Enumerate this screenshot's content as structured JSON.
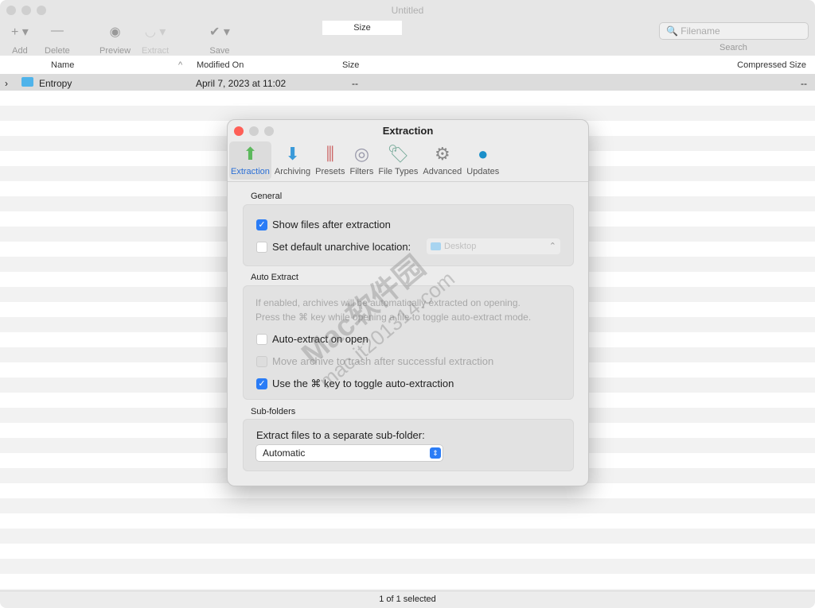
{
  "window": {
    "title": "Untitled",
    "status": "1 of 1 selected"
  },
  "toolbar": {
    "add": "Add",
    "delete": "Delete",
    "preview": "Preview",
    "extract": "Extract",
    "save": "Save",
    "size": "Size",
    "search_placeholder": "Filename",
    "search_label": "Search"
  },
  "columns": {
    "name": "Name",
    "modified": "Modified On",
    "size": "Size",
    "compressed": "Compressed Size"
  },
  "rows": [
    {
      "name": "Entropy",
      "modified": "April 7, 2023 at 11:02",
      "size": "--",
      "compressed": "--"
    }
  ],
  "dialog": {
    "title": "Extraction",
    "tabs": [
      {
        "label": "Extraction",
        "icon": "extraction-icon"
      },
      {
        "label": "Archiving",
        "icon": "archiving-icon"
      },
      {
        "label": "Presets",
        "icon": "presets-icon"
      },
      {
        "label": "Filters",
        "icon": "filters-icon"
      },
      {
        "label": "File Types",
        "icon": "file-types-icon"
      },
      {
        "label": "Advanced",
        "icon": "gear-icon"
      },
      {
        "label": "Updates",
        "icon": "globe-icon"
      }
    ],
    "general": {
      "heading": "General",
      "show_files": "Show files after extraction",
      "show_files_checked": true,
      "default_location": "Set default unarchive location:",
      "default_location_checked": false,
      "location_value": "Desktop"
    },
    "auto": {
      "heading": "Auto Extract",
      "help1": "If enabled, archives will be automatically extracted on opening.",
      "help2": "Press the ⌘ key while opening a file to toggle auto-extract mode.",
      "auto_open": "Auto-extract on open",
      "auto_open_checked": false,
      "move_trash": "Move archive to trash after successful extraction",
      "move_trash_checked": false,
      "use_key": "Use the ⌘ key to toggle auto-extraction",
      "use_key_checked": true
    },
    "subfolders": {
      "heading": "Sub-folders",
      "label": "Extract files to a separate sub-folder:",
      "value": "Automatic"
    }
  },
  "watermark": {
    "line1": "Mac软件园",
    "line2": "mac.it201314.com"
  }
}
